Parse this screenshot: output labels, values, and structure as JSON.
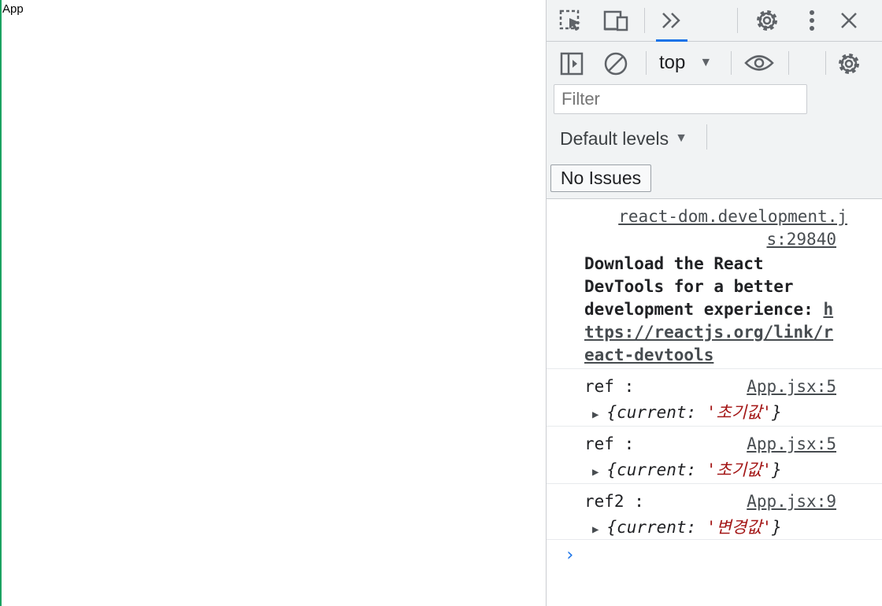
{
  "page": {
    "text": "App"
  },
  "devtools": {
    "toolbar": {
      "inspect_icon": "element-picker-icon",
      "device_icon": "device-toolbar-icon",
      "more_tabs_icon": "more-tabs-icon",
      "settings_icon": "gear-icon",
      "menu_icon": "vertical-dots-icon",
      "close_icon": "close-icon"
    },
    "console_toolbar": {
      "sidebar_icon": "sidebar-toggle-icon",
      "clear_icon": "clear-console-icon",
      "context": "top",
      "live_expr_icon": "eye-icon",
      "settings_icon": "gear-icon",
      "filter_placeholder": "Filter",
      "levels": "Default levels",
      "issues": "No Issues"
    },
    "messages": [
      {
        "source": "react-dom.development.js:29840",
        "source_line1": "react-dom.development.j",
        "source_line2": "s:29840",
        "text_line1": "Download the React",
        "text_line2": "DevTools for a better",
        "text_line3": "development experience: ",
        "link_part1": "h",
        "link_part2": "ttps://reactjs.org/link/r",
        "link_part3": "eact-devtools"
      },
      {
        "label": "ref :",
        "source": "App.jsx:5",
        "key": "current",
        "value": "'초기값'"
      },
      {
        "label": "ref :",
        "source": "App.jsx:5",
        "key": "current",
        "value": "'초기값'"
      },
      {
        "label": "ref2 :",
        "source": "App.jsx:9",
        "key": "current",
        "value": "'변경값'"
      }
    ],
    "prompt": "›"
  },
  "colors": {
    "accent": "#1a73e8",
    "string": "#a31515",
    "page_border": "#1aa260"
  }
}
